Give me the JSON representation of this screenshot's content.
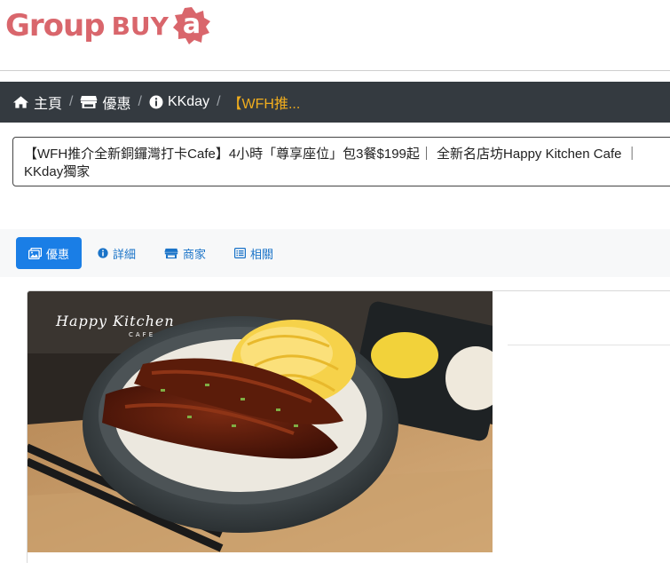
{
  "logo": {
    "part1": "Group",
    "part2": "BUY",
    "badge": "a",
    "color": "#d9666c"
  },
  "breadcrumb": {
    "items": [
      {
        "label": "主頁",
        "icon": "home-icon"
      },
      {
        "label": "優惠",
        "icon": "store-icon"
      },
      {
        "label": "KKday",
        "icon": "info-icon"
      },
      {
        "label": "【WFH推..."
      }
    ],
    "separator": "/",
    "active_color": "#f0ad1e",
    "bar_color": "#343a40"
  },
  "title": "【WFH推介全新銅鑼灣打卡Cafe】4小時「尊享座位」包3餐$199起｜ 全新名店坊Happy Kitchen Cafe ｜KKday獨家",
  "tabs": [
    {
      "label": "優惠",
      "icon": "image-icon",
      "active": true
    },
    {
      "label": "詳細",
      "icon": "info-icon",
      "active": false
    },
    {
      "label": "商家",
      "icon": "store-icon",
      "active": false
    },
    {
      "label": "相關",
      "icon": "list-icon",
      "active": false
    }
  ],
  "tab_active_color": "#1a7ee6",
  "photo": {
    "brand": "Happy Kitchen",
    "brand_sub": "CAFE",
    "alt": "eel rice bowl"
  }
}
